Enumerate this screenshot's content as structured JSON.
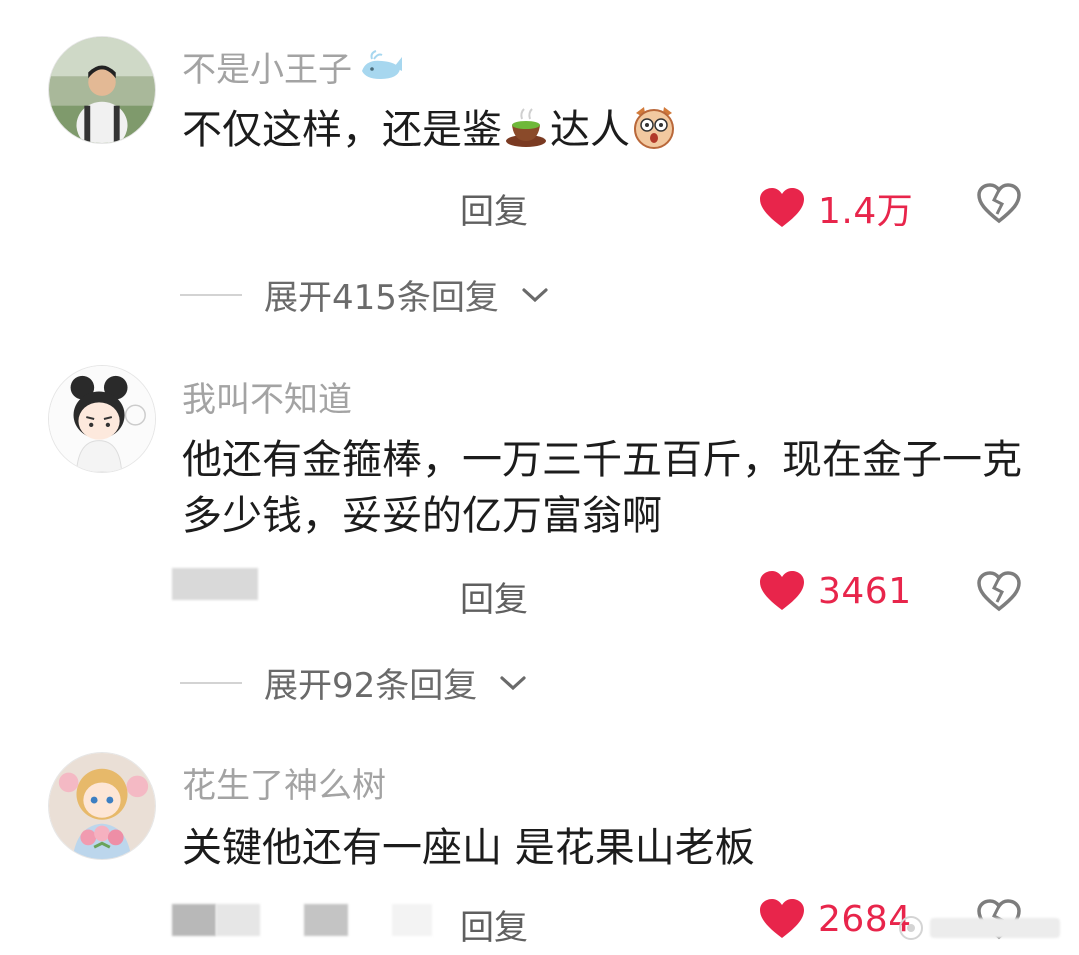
{
  "comments": [
    {
      "username": "不是小王子",
      "username_icon": "whale-icon",
      "text": "不仅这样，还是鉴",
      "text_tail": "达人",
      "inline_emojis": [
        "tea-icon",
        "surprised-dog-icon"
      ],
      "reply_label": "回复",
      "like_count": "1.4万",
      "expand_label": "展开415条回复"
    },
    {
      "username": "我叫不知道",
      "text": "他还有金箍棒，一万三千五百斤，现在金子一克多少钱，妥妥的亿万富翁啊",
      "reply_label": "回复",
      "like_count": "3461",
      "expand_label": "展开92条回复"
    },
    {
      "username": "花生了神么树",
      "text": "关键他还有一座山 是花果山老板",
      "reply_label": "回复",
      "like_count": "2684"
    }
  ],
  "colors": {
    "like": "#e8254b",
    "username": "#a3a3a3",
    "text": "#1c1c1c",
    "reply": "#5f5f5f"
  },
  "icons": {
    "like": "heart-icon",
    "dislike": "broken-heart-icon",
    "expand": "chevron-down-icon"
  }
}
